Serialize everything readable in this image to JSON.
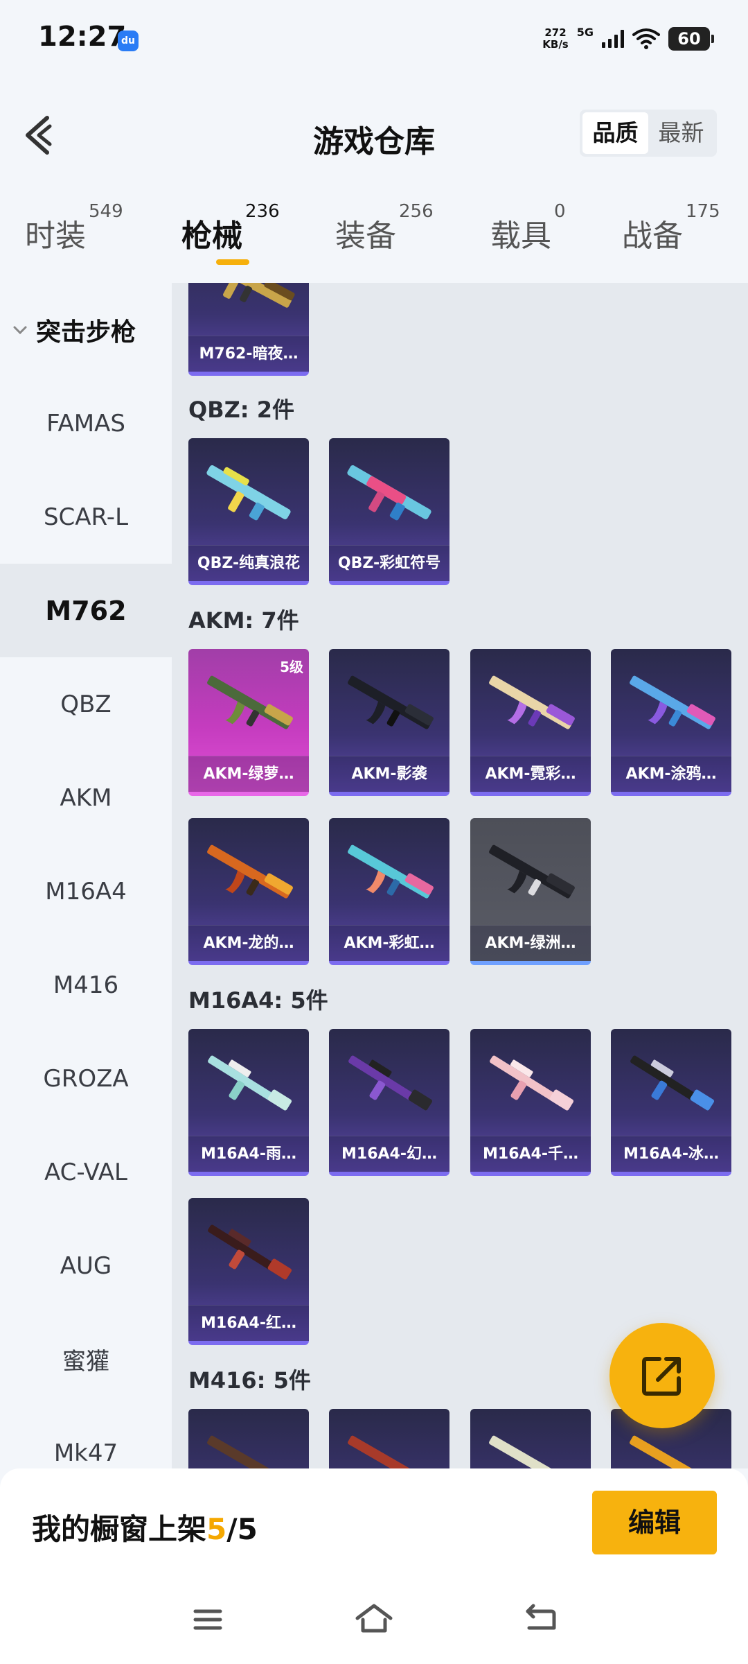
{
  "status_bar": {
    "time": "12:27",
    "app_icon": "du",
    "net_speed": "272",
    "net_unit": "KB/s",
    "network": "5G",
    "battery": "60"
  },
  "header": {
    "title": "游戏仓库",
    "sort_options": [
      "品质",
      "最新"
    ],
    "sort_active": "品质"
  },
  "category_tabs": [
    {
      "label": "时装",
      "count": "549"
    },
    {
      "label": "枪械",
      "count": "236"
    },
    {
      "label": "装备",
      "count": "256"
    },
    {
      "label": "载具",
      "count": "0"
    },
    {
      "label": "战备",
      "count": "175"
    }
  ],
  "active_tab": "枪械",
  "sidebar": {
    "group": "突击步枪",
    "items": [
      "FAMAS",
      "SCAR-L",
      "M762",
      "QBZ",
      "AKM",
      "M16A4",
      "M416",
      "GROZA",
      "AC-VAL",
      "AUG",
      "蜜獾",
      "Mk47"
    ],
    "active": "M762"
  },
  "content": {
    "top_card": "M762-暗夜…",
    "sections": [
      {
        "title": "QBZ: 2件",
        "items": [
          "QBZ-纯真浪花",
          "QBZ-彩虹符号"
        ]
      },
      {
        "title": "AKM: 7件",
        "items": [
          "AKM-绿萝…",
          "AKM-影袭",
          "AKM-霓彩…",
          "AKM-涂鸦…",
          "AKM-龙的…",
          "AKM-彩虹…",
          "AKM-绿洲…"
        ],
        "badge": "5级"
      },
      {
        "title": "M16A4: 5件",
        "items": [
          "M16A4-雨…",
          "M16A4-幻…",
          "M16A4-千…",
          "M16A4-冰…",
          "M16A4-红…"
        ]
      },
      {
        "title": "M416: 5件"
      }
    ]
  },
  "bottom": {
    "shelf_label": "我的橱窗上架",
    "shelf_current": "5",
    "shelf_sep": "/",
    "shelf_total": "5",
    "edit_label": "编辑"
  },
  "colors": {
    "accent": "#f7b20e",
    "card_purple": "#3a3370",
    "card_pink": "#c53cbf"
  },
  "icons": [
    "back-icon",
    "share-icon",
    "menu-icon",
    "home-icon",
    "back-nav-icon",
    "chevron-down-icon"
  ]
}
